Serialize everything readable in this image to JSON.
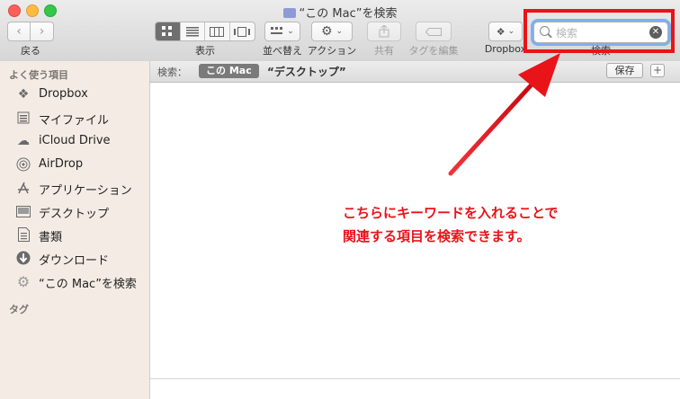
{
  "window": {
    "title": "“この Mac”を検索"
  },
  "toolbar": {
    "back_label": "戻る",
    "view_label": "表示",
    "arrange_label": "並べ替え",
    "action_label": "アクション",
    "share_label": "共有",
    "tags_label": "タグを編集",
    "dropbox_label": "Dropbox",
    "search_label": "検索",
    "search_placeholder": "検索"
  },
  "sidebar": {
    "favorites_header": "よく使う項目",
    "tags_header": "タグ",
    "items": [
      {
        "label": "Dropbox",
        "icon": "dropbox-icon"
      },
      {
        "label": "マイファイル",
        "icon": "all-files-icon"
      },
      {
        "label": "iCloud Drive",
        "icon": "cloud-icon"
      },
      {
        "label": "AirDrop",
        "icon": "airdrop-icon"
      },
      {
        "label": "アプリケーション",
        "icon": "applications-icon"
      },
      {
        "label": "デスクトップ",
        "icon": "desktop-icon"
      },
      {
        "label": "書類",
        "icon": "documents-icon"
      },
      {
        "label": "ダウンロード",
        "icon": "download-icon"
      },
      {
        "label": "“この Mac”を検索",
        "icon": "gear-icon"
      }
    ]
  },
  "scope": {
    "label": "検索：",
    "this_mac": "この Mac",
    "desktop": "“デスクトップ”",
    "save": "保存",
    "add": "+"
  },
  "annotation": {
    "line1": "こちらにキーワードを入れることで",
    "line2": "関連する項目を検索できます。"
  },
  "colors": {
    "highlight": "#e8141a",
    "sidebar_bg": "#f4ece4"
  }
}
